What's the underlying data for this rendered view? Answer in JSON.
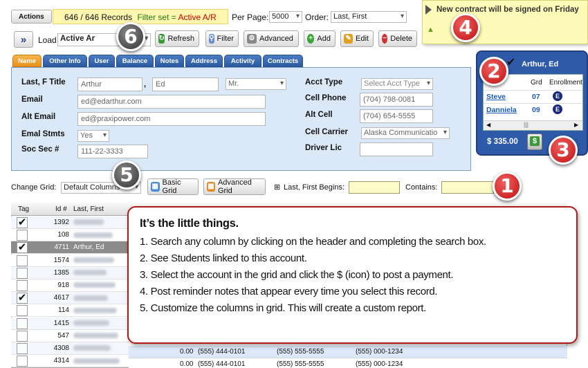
{
  "toolbar": {
    "actions_label": "Actions",
    "records": "646 / 646 Records",
    "filter_set_label": "Filter set = ",
    "filter_set_value": "Active A/R",
    "per_page_label": "Per Page:",
    "per_page_value": "5000",
    "order_label": "Order:",
    "order_value": "Last, First",
    "load_label": "Load",
    "load_value": "Active Ar",
    "refresh": "Refresh",
    "filter": "Filter",
    "advanced": "Advanced",
    "add": "Add",
    "edit": "Edit",
    "delete": "Delete"
  },
  "note": {
    "text": "New contract will be signed on Friday"
  },
  "tabs": [
    "Name",
    "Other Info",
    "User",
    "Balance",
    "Notes",
    "Address",
    "Activity",
    "Contracts"
  ],
  "form": {
    "last_first_title_label": "Last, F Title",
    "last_value": "Arthur",
    "first_value": "Ed",
    "title_value": "Mr.",
    "email_label": "Email",
    "email_value": "ed@edarthur.com",
    "alt_email_label": "Alt Email",
    "alt_email_value": "ed@praxipower.com",
    "email_stmts_label": "Emal Stmts",
    "email_stmts_value": "Yes",
    "ssn_label": "Soc Sec #",
    "ssn_value": "111-22-3333",
    "acct_type_label": "Acct Type",
    "acct_type_placeholder": "Select Acct Type",
    "cell_phone_label": "Cell Phone",
    "cell_phone_value": "(704) 798-0081",
    "alt_cell_label": "Alt Cell",
    "alt_cell_value": "(704) 654-5555",
    "cell_carrier_label": "Cell Carrier",
    "cell_carrier_value": "Alaska Communicatio",
    "driver_lic_label": "Driver Lic"
  },
  "students": {
    "title": "Arthur, Ed",
    "col_grd": "Grd",
    "col_enroll": "Enrollment",
    "rows": [
      {
        "name": "Steve",
        "grd": "07"
      },
      {
        "name": "Danniela",
        "grd": "09"
      }
    ],
    "amount": "$ 335.00"
  },
  "grid_bar": {
    "change_grid_label": "Change Grid:",
    "grid_value": "Default Columns",
    "basic_grid": "Basic Grid",
    "advanced_grid": "Advanced Grid",
    "begins_label": "Last, First Begins:",
    "contains_label": "Contains:"
  },
  "grid": {
    "headers": [
      "Tag",
      "Id #",
      "Last, First"
    ],
    "rows": [
      {
        "tag": true,
        "id": "1392",
        "name": ""
      },
      {
        "tag": false,
        "id": "108",
        "name": ""
      },
      {
        "tag": true,
        "id": "4711",
        "name": "Arthur, Ed"
      },
      {
        "tag": false,
        "id": "1574",
        "name": ""
      },
      {
        "tag": false,
        "id": "1385",
        "name": ""
      },
      {
        "tag": false,
        "id": "918",
        "name": ""
      },
      {
        "tag": true,
        "id": "4617",
        "name": ""
      },
      {
        "tag": false,
        "id": "114",
        "name": ""
      },
      {
        "tag": false,
        "id": "1415",
        "name": ""
      },
      {
        "tag": false,
        "id": "547",
        "name": ""
      },
      {
        "tag": false,
        "id": "4308",
        "name": ""
      },
      {
        "tag": false,
        "id": "4314",
        "name": ""
      }
    ],
    "bottom_rows": [
      {
        "bal": "0.00",
        "p1": "(555) 444-0101",
        "p2": "(555) 555-5555",
        "p3": "(555) 000-1234"
      },
      {
        "bal": "0.00",
        "p1": "(555) 444-0101",
        "p2": "(555) 555-5555",
        "p3": "(555) 000-1234"
      }
    ]
  },
  "callout": {
    "title": "It’s the little things.",
    "items": [
      "1. Search any column by clicking on the header and completing the search box.",
      "2. See Students linked to this account.",
      "3. Select the account in the grid and click the $ (icon) to post a payment.",
      "4. Post reminder notes that appear every time you select this record.",
      "5. Customize the columns in grid.   This will create a custom report."
    ]
  },
  "badges": [
    "1",
    "2",
    "3",
    "4",
    "5",
    "6"
  ]
}
